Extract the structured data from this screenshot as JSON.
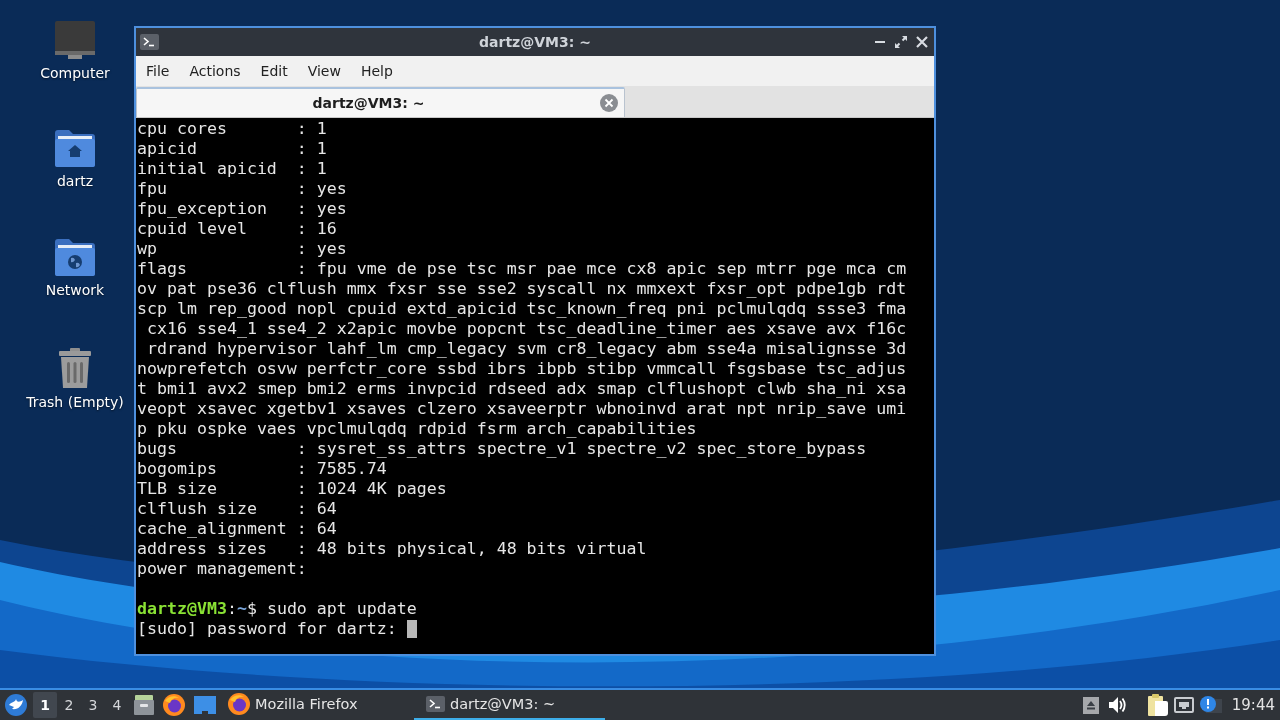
{
  "desktop_icons": [
    {
      "label": "Computer",
      "kind": "computer"
    },
    {
      "label": "dartz",
      "kind": "home"
    },
    {
      "label": "Network",
      "kind": "network"
    },
    {
      "label": "Trash (Empty)",
      "kind": "trash"
    }
  ],
  "window": {
    "title": "dartz@VM3: ~",
    "menu": [
      "File",
      "Actions",
      "Edit",
      "View",
      "Help"
    ],
    "tabs": [
      {
        "label": "dartz@VM3: ~",
        "selected": true
      }
    ],
    "terminal": {
      "lines": [
        "cpu cores       : 1",
        "apicid          : 1",
        "initial apicid  : 1",
        "fpu             : yes",
        "fpu_exception   : yes",
        "cpuid level     : 16",
        "wp              : yes",
        "flags           : fpu vme de pse tsc msr pae mce cx8 apic sep mtrr pge mca cm",
        "ov pat pse36 clflush mmx fxsr sse sse2 syscall nx mmxext fxsr_opt pdpe1gb rdt",
        "scp lm rep_good nopl cpuid extd_apicid tsc_known_freq pni pclmulqdq ssse3 fma",
        " cx16 sse4_1 sse4_2 x2apic movbe popcnt tsc_deadline_timer aes xsave avx f16c",
        " rdrand hypervisor lahf_lm cmp_legacy svm cr8_legacy abm sse4a misalignsse 3d",
        "nowprefetch osvw perfctr_core ssbd ibrs ibpb stibp vmmcall fsgsbase tsc_adjus",
        "t bmi1 avx2 smep bmi2 erms invpcid rdseed adx smap clflushopt clwb sha_ni xsa",
        "veopt xsavec xgetbv1 xsaves clzero xsaveerptr wbnoinvd arat npt nrip_save umi",
        "p pku ospke vaes vpclmulqdq rdpid fsrm arch_capabilities",
        "bugs            : sysret_ss_attrs spectre_v1 spectre_v2 spec_store_bypass",
        "bogomips        : 7585.74",
        "TLB size        : 1024 4K pages",
        "clflush size    : 64",
        "cache_alignment : 64",
        "address sizes   : 48 bits physical, 48 bits virtual",
        "power management:"
      ],
      "prompt": [
        {
          "kind": "user",
          "text": "dartz@VM3"
        },
        {
          "kind": "plain",
          "text": ":"
        },
        {
          "kind": "path",
          "text": "~"
        },
        {
          "kind": "plain",
          "text": "$ sudo apt update"
        }
      ],
      "password_prompt": "[sudo] password for dartz:"
    }
  },
  "taskbar": {
    "workspaces": [
      {
        "label": "1",
        "selected": true
      },
      {
        "label": "2",
        "selected": false
      },
      {
        "label": "3",
        "selected": false
      },
      {
        "label": "4",
        "selected": false
      }
    ],
    "tasks": [
      {
        "label": "Mozilla Firefox",
        "kind": "browser",
        "selected": false
      },
      {
        "label": "dartz@VM3: ~",
        "kind": "terminal",
        "selected": true
      }
    ],
    "clock": "19:44"
  }
}
